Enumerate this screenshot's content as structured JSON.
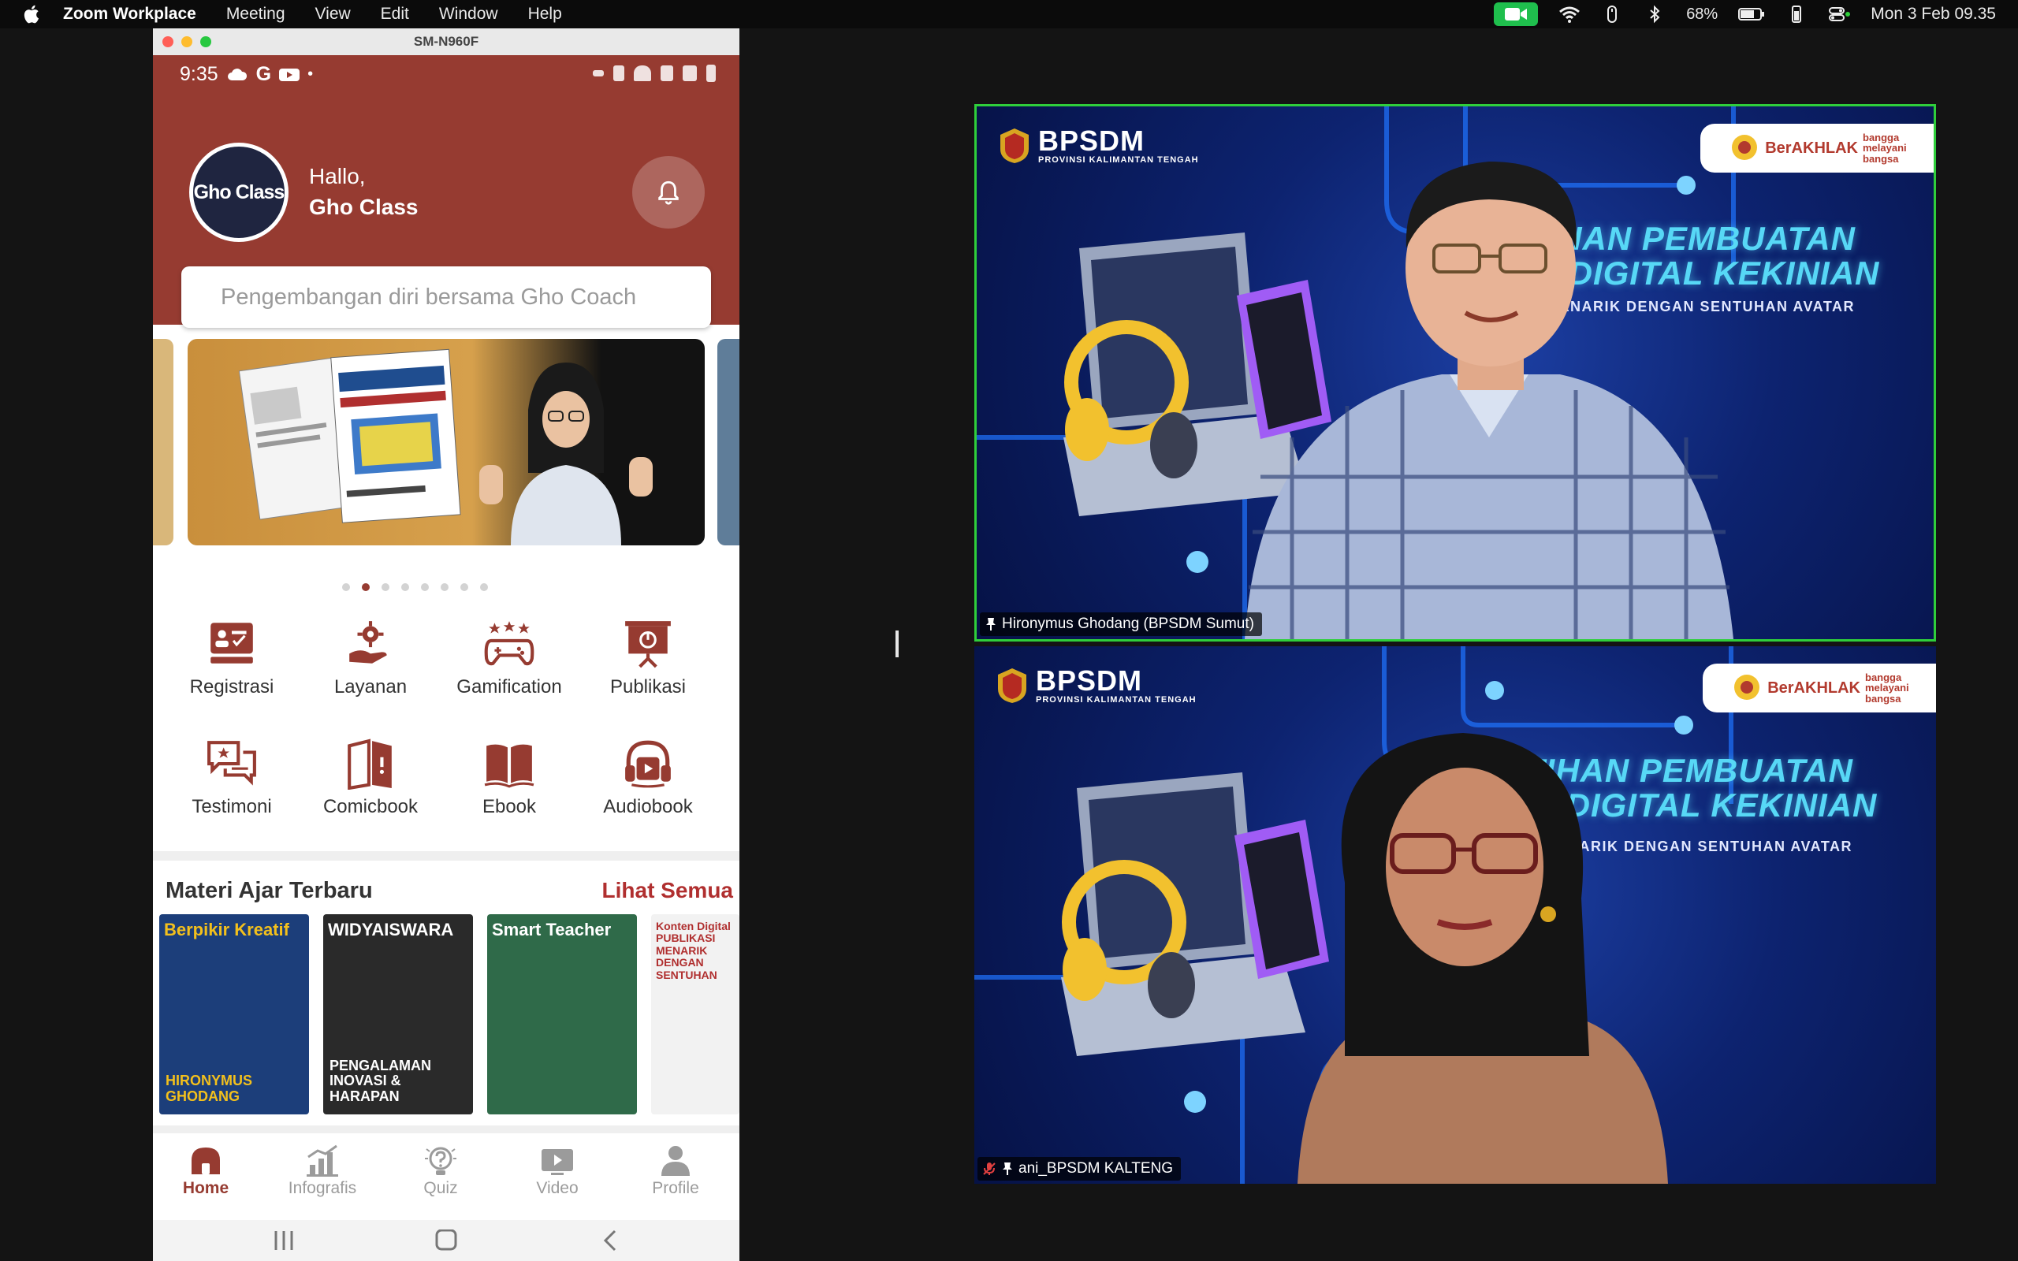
{
  "menubar": {
    "app_name": "Zoom Workplace",
    "items": [
      "Meeting",
      "View",
      "Edit",
      "Window",
      "Help"
    ],
    "battery": "68%",
    "clock": "Mon 3 Feb 09.35"
  },
  "phone_window": {
    "title": "SM-N960F",
    "status_time": "9:35",
    "avatar_text": "Gho Class",
    "greeting": "Hallo,",
    "user_name": "Gho Class",
    "search_placeholder": "Pengembangan diri bersama Gho Coach",
    "carousel": {
      "count": 8,
      "active_index": 1
    },
    "menu": [
      {
        "label": "Registrasi",
        "icon": "registration-icon"
      },
      {
        "label": "Layanan",
        "icon": "service-icon"
      },
      {
        "label": "Gamification",
        "icon": "gamepad-icon"
      },
      {
        "label": "Publikasi",
        "icon": "presentation-icon"
      },
      {
        "label": "Testimoni",
        "icon": "testimonial-icon"
      },
      {
        "label": "Comicbook",
        "icon": "comicbook-icon"
      },
      {
        "label": "Ebook",
        "icon": "ebook-icon"
      },
      {
        "label": "Audiobook",
        "icon": "audiobook-icon"
      }
    ],
    "section_title": "Materi Ajar Terbaru",
    "see_all": "Lihat Semua",
    "books": [
      {
        "title": "Berpikir Kreatif",
        "subtitle": "HIRONYMUS GHODANG",
        "bg": "#1c3e7a",
        "fg": "#f3c01c"
      },
      {
        "title": "WIDYAISWARA",
        "subtitle": "PENGALAMAN INOVASI & HARAPAN",
        "bg": "#2a2a2a",
        "fg": "#ffffff"
      },
      {
        "title": "Smart Teacher",
        "subtitle": "",
        "bg": "#2f6a49",
        "fg": "#ffffff"
      },
      {
        "title": "Konten Digital PUBLIKASI MENARIK DENGAN SENTUHAN",
        "subtitle": "",
        "bg": "#f2f2f2",
        "fg": "#b02f2f"
      }
    ],
    "bottom_nav": [
      {
        "label": "Home",
        "icon": "home-icon",
        "active": true
      },
      {
        "label": "Infografis",
        "icon": "infographic-icon",
        "active": false
      },
      {
        "label": "Quiz",
        "icon": "quiz-icon",
        "active": false
      },
      {
        "label": "Video",
        "icon": "video-icon",
        "active": false
      },
      {
        "label": "Profile",
        "icon": "profile-icon",
        "active": false
      }
    ]
  },
  "video_tiles": [
    {
      "name": "Hironymus Ghodang (BPSDM Sumut)",
      "active_speaker": true,
      "bpsdm": "BPSDM",
      "bpsdm_sub": "PROVINSI KALIMANTAN TENGAH",
      "badge": "BerAKHLAK",
      "badge_sub": "bangga melayani bangsa",
      "headline_line1": "PELATIHAN PEMBUATAN",
      "headline_line2": "KONTEN DIGITAL KEKINIAN",
      "subhead": "PUBLIKASI MENARIK DENGAN SENTUHAN AVATAR"
    },
    {
      "name": "ani_BPSDM KALTENG",
      "active_speaker": false,
      "muted": true,
      "bpsdm": "BPSDM",
      "bpsdm_sub": "PROVINSI KALIMANTAN TENGAH",
      "badge": "BerAKHLAK",
      "badge_sub": "bangga melayani bangsa",
      "headline_line1": "PELATIHAN PEMBUATAN",
      "headline_line2": "KONTEN DIGITAL KEKINIAN",
      "subhead": "PUBLIKASI MENARIK DENGAN SENTUHAN AVATAR"
    }
  ],
  "colors": {
    "brand": "#963b31",
    "accent_red": "#b02f2f",
    "active_speaker_border": "#2fcf3b",
    "headline": "#57d8f6"
  }
}
